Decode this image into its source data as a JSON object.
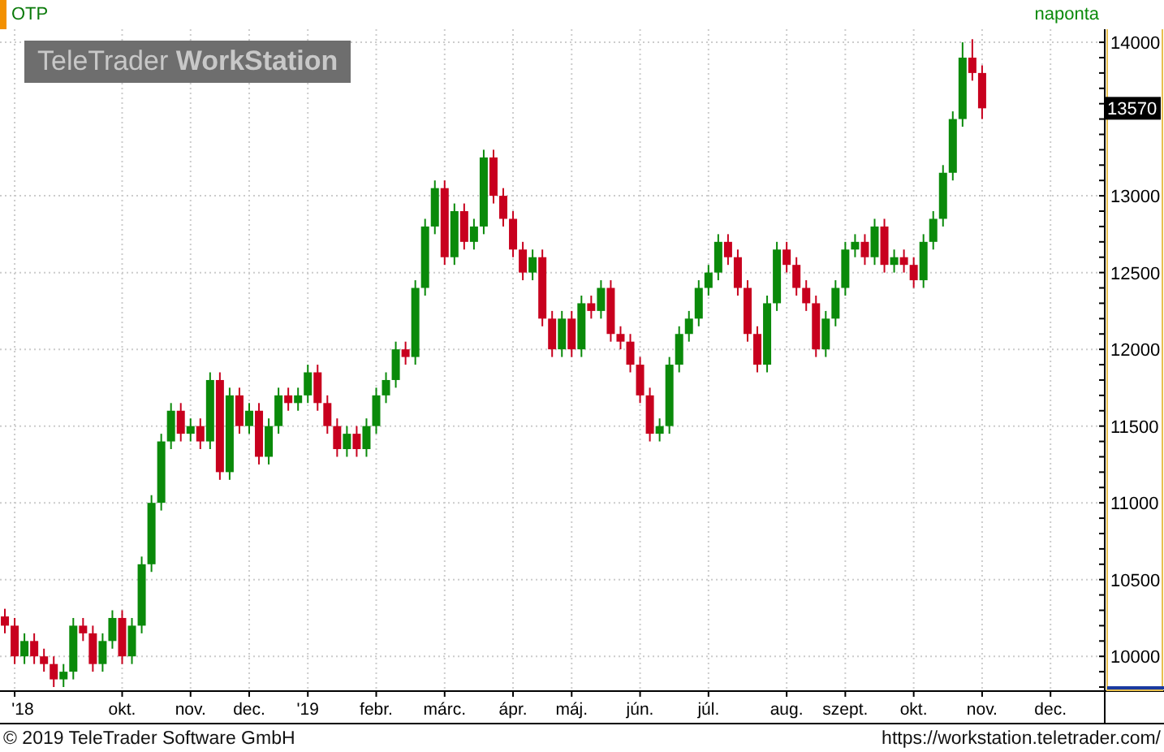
{
  "header": {
    "symbol": "OTP",
    "interval": "naponta"
  },
  "logo": "TeleTrader **WorkStation**",
  "chart_data": {
    "type": "candlestick",
    "grid": true,
    "ylim": [
      9779,
      14085
    ],
    "yticks": [
      10000,
      10500,
      11000,
      11500,
      12000,
      12500,
      13000,
      14000
    ],
    "categories": [
      null,
      "'18",
      null,
      null,
      null,
      null,
      null,
      null,
      null,
      null,
      null,
      null,
      "okt.",
      null,
      null,
      null,
      null,
      null,
      null,
      "nov.",
      null,
      null,
      null,
      null,
      null,
      "dec.",
      null,
      null,
      null,
      null,
      null,
      "'19",
      null,
      null,
      null,
      null,
      null,
      null,
      "febr.",
      null,
      null,
      null,
      null,
      null,
      null,
      "márc.",
      null,
      null,
      null,
      null,
      null,
      null,
      "ápr.",
      null,
      null,
      null,
      null,
      null,
      "máj.",
      null,
      null,
      null,
      null,
      null,
      null,
      "jún.",
      null,
      null,
      null,
      null,
      null,
      null,
      "júl.",
      null,
      null,
      null,
      null,
      null,
      null,
      null,
      "aug.",
      null,
      null,
      null,
      null,
      null,
      "szept.",
      null,
      null,
      null,
      null,
      null,
      null,
      "okt.",
      null,
      null,
      null,
      null,
      null,
      null,
      "nov.",
      null,
      null,
      null,
      null,
      null,
      null,
      "dec.",
      null,
      null,
      null,
      null
    ],
    "ohlc": [
      [
        10260,
        10310,
        10150,
        10200
      ],
      [
        10200,
        10250,
        9950,
        10000
      ],
      [
        10000,
        10150,
        9950,
        10100
      ],
      [
        10100,
        10150,
        9950,
        10000
      ],
      [
        10000,
        10050,
        9900,
        9950
      ],
      [
        9950,
        10000,
        9800,
        9850
      ],
      [
        9850,
        9950,
        9800,
        9900
      ],
      [
        9900,
        10250,
        9850,
        10200
      ],
      [
        10200,
        10250,
        10100,
        10150
      ],
      [
        10150,
        10200,
        9900,
        9950
      ],
      [
        9950,
        10150,
        9900,
        10100
      ],
      [
        10100,
        10300,
        10050,
        10250
      ],
      [
        10250,
        10300,
        9950,
        10000
      ],
      [
        10000,
        10250,
        9950,
        10200
      ],
      [
        10200,
        10650,
        10150,
        10600
      ],
      [
        10600,
        11050,
        10550,
        11000
      ],
      [
        11000,
        11450,
        10950,
        11400
      ],
      [
        11400,
        11650,
        11350,
        11600
      ],
      [
        11600,
        11650,
        11400,
        11450
      ],
      [
        11450,
        11550,
        11400,
        11500
      ],
      [
        11500,
        11550,
        11350,
        11400
      ],
      [
        11400,
        11850,
        11350,
        11800
      ],
      [
        11800,
        11850,
        11150,
        11200
      ],
      [
        11200,
        11750,
        11150,
        11700
      ],
      [
        11700,
        11750,
        11450,
        11500
      ],
      [
        11500,
        11650,
        11450,
        11600
      ],
      [
        11600,
        11650,
        11250,
        11300
      ],
      [
        11300,
        11550,
        11250,
        11500
      ],
      [
        11500,
        11750,
        11450,
        11700
      ],
      [
        11700,
        11750,
        11600,
        11650
      ],
      [
        11650,
        11750,
        11600,
        11700
      ],
      [
        11700,
        11900,
        11650,
        11850
      ],
      [
        11850,
        11900,
        11600,
        11650
      ],
      [
        11650,
        11700,
        11450,
        11500
      ],
      [
        11500,
        11550,
        11300,
        11350
      ],
      [
        11350,
        11500,
        11300,
        11450
      ],
      [
        11450,
        11500,
        11300,
        11350
      ],
      [
        11350,
        11550,
        11300,
        11500
      ],
      [
        11500,
        11750,
        11450,
        11700
      ],
      [
        11700,
        11850,
        11650,
        11800
      ],
      [
        11800,
        12050,
        11750,
        12000
      ],
      [
        12000,
        12050,
        11900,
        11950
      ],
      [
        11950,
        12450,
        11900,
        12400
      ],
      [
        12400,
        12850,
        12350,
        12800
      ],
      [
        12800,
        13100,
        12750,
        13050
      ],
      [
        13050,
        13100,
        12550,
        12600
      ],
      [
        12600,
        12950,
        12550,
        12900
      ],
      [
        12900,
        12950,
        12650,
        12700
      ],
      [
        12700,
        12850,
        12650,
        12800
      ],
      [
        12800,
        13300,
        12750,
        13250
      ],
      [
        13250,
        13300,
        12950,
        13000
      ],
      [
        13000,
        13050,
        12800,
        12850
      ],
      [
        12850,
        12900,
        12600,
        12650
      ],
      [
        12650,
        12700,
        12450,
        12500
      ],
      [
        12500,
        12650,
        12450,
        12600
      ],
      [
        12600,
        12650,
        12150,
        12200
      ],
      [
        12200,
        12250,
        11950,
        12000
      ],
      [
        12000,
        12250,
        11950,
        12200
      ],
      [
        12200,
        12250,
        11950,
        12000
      ],
      [
        12000,
        12350,
        11950,
        12300
      ],
      [
        12300,
        12350,
        12200,
        12250
      ],
      [
        12250,
        12450,
        12200,
        12400
      ],
      [
        12400,
        12450,
        12050,
        12100
      ],
      [
        12100,
        12150,
        12000,
        12050
      ],
      [
        12050,
        12100,
        11850,
        11900
      ],
      [
        11900,
        11950,
        11650,
        11700
      ],
      [
        11700,
        11750,
        11400,
        11450
      ],
      [
        11450,
        11550,
        11400,
        11500
      ],
      [
        11500,
        11950,
        11450,
        11900
      ],
      [
        11900,
        12150,
        11850,
        12100
      ],
      [
        12100,
        12250,
        12050,
        12200
      ],
      [
        12200,
        12450,
        12150,
        12400
      ],
      [
        12400,
        12550,
        12350,
        12500
      ],
      [
        12500,
        12750,
        12450,
        12700
      ],
      [
        12700,
        12750,
        12550,
        12600
      ],
      [
        12600,
        12650,
        12350,
        12400
      ],
      [
        12400,
        12450,
        12050,
        12100
      ],
      [
        12100,
        12150,
        11850,
        11900
      ],
      [
        11900,
        12350,
        11850,
        12300
      ],
      [
        12300,
        12700,
        12250,
        12650
      ],
      [
        12650,
        12700,
        12500,
        12550
      ],
      [
        12550,
        12600,
        12350,
        12400
      ],
      [
        12400,
        12450,
        12250,
        12300
      ],
      [
        12300,
        12350,
        11950,
        12000
      ],
      [
        12000,
        12250,
        11950,
        12200
      ],
      [
        12200,
        12450,
        12150,
        12400
      ],
      [
        12400,
        12700,
        12350,
        12650
      ],
      [
        12650,
        12750,
        12600,
        12700
      ],
      [
        12700,
        12750,
        12550,
        12600
      ],
      [
        12600,
        12850,
        12550,
        12800
      ],
      [
        12800,
        12850,
        12500,
        12550
      ],
      [
        12550,
        12650,
        12500,
        12600
      ],
      [
        12600,
        12650,
        12500,
        12550
      ],
      [
        12550,
        12600,
        12400,
        12450
      ],
      [
        12450,
        12750,
        12400,
        12700
      ],
      [
        12700,
        12900,
        12650,
        12850
      ],
      [
        12850,
        13200,
        12800,
        13150
      ],
      [
        13150,
        13550,
        13100,
        13500
      ],
      [
        13500,
        14000,
        13450,
        13900
      ],
      [
        13900,
        14020,
        13750,
        13800
      ],
      [
        13800,
        13850,
        13500,
        13570
      ],
      null,
      null,
      null,
      null,
      null,
      null,
      null,
      null,
      null,
      null,
      null
    ],
    "annotations": [
      {
        "y": 13570,
        "text": "13570"
      }
    ]
  },
  "footer": {
    "copyright": "© 2019 TeleTrader Software GmbH",
    "url": "https://workstation.teletrader.com/"
  }
}
